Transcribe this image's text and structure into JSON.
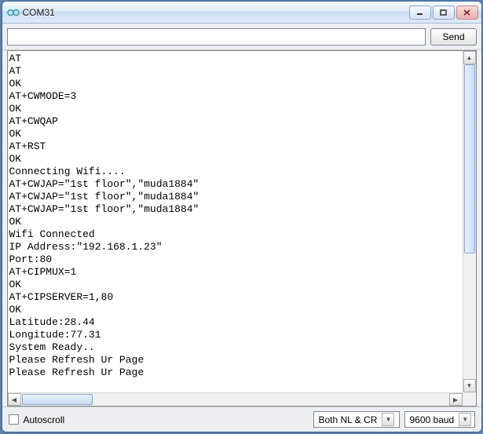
{
  "window": {
    "title": "COM31"
  },
  "toolbar": {
    "input_value": "",
    "send_label": "Send"
  },
  "terminal": {
    "lines": [
      "AT",
      "AT",
      "OK",
      "AT+CWMODE=3",
      "OK",
      "AT+CWQAP",
      "OK",
      "AT+RST",
      "OK",
      "Connecting Wifi....",
      "AT+CWJAP=\"1st floor\",\"muda1884\"",
      "AT+CWJAP=\"1st floor\",\"muda1884\"",
      "AT+CWJAP=\"1st floor\",\"muda1884\"",
      "OK",
      "Wifi Connected",
      "IP Address:\"192.168.1.23\"",
      "Port:80",
      "AT+CIPMUX=1",
      "OK",
      "AT+CIPSERVER=1,80",
      "OK",
      "Latitude:28.44",
      "Longitude:77.31",
      "System Ready..",
      "Please Refresh Ur Page",
      "Please Refresh Ur Page"
    ]
  },
  "statusbar": {
    "autoscroll_label": "Autoscroll",
    "autoscroll_checked": false,
    "line_ending": "Both NL & CR",
    "baud": "9600 baud"
  }
}
